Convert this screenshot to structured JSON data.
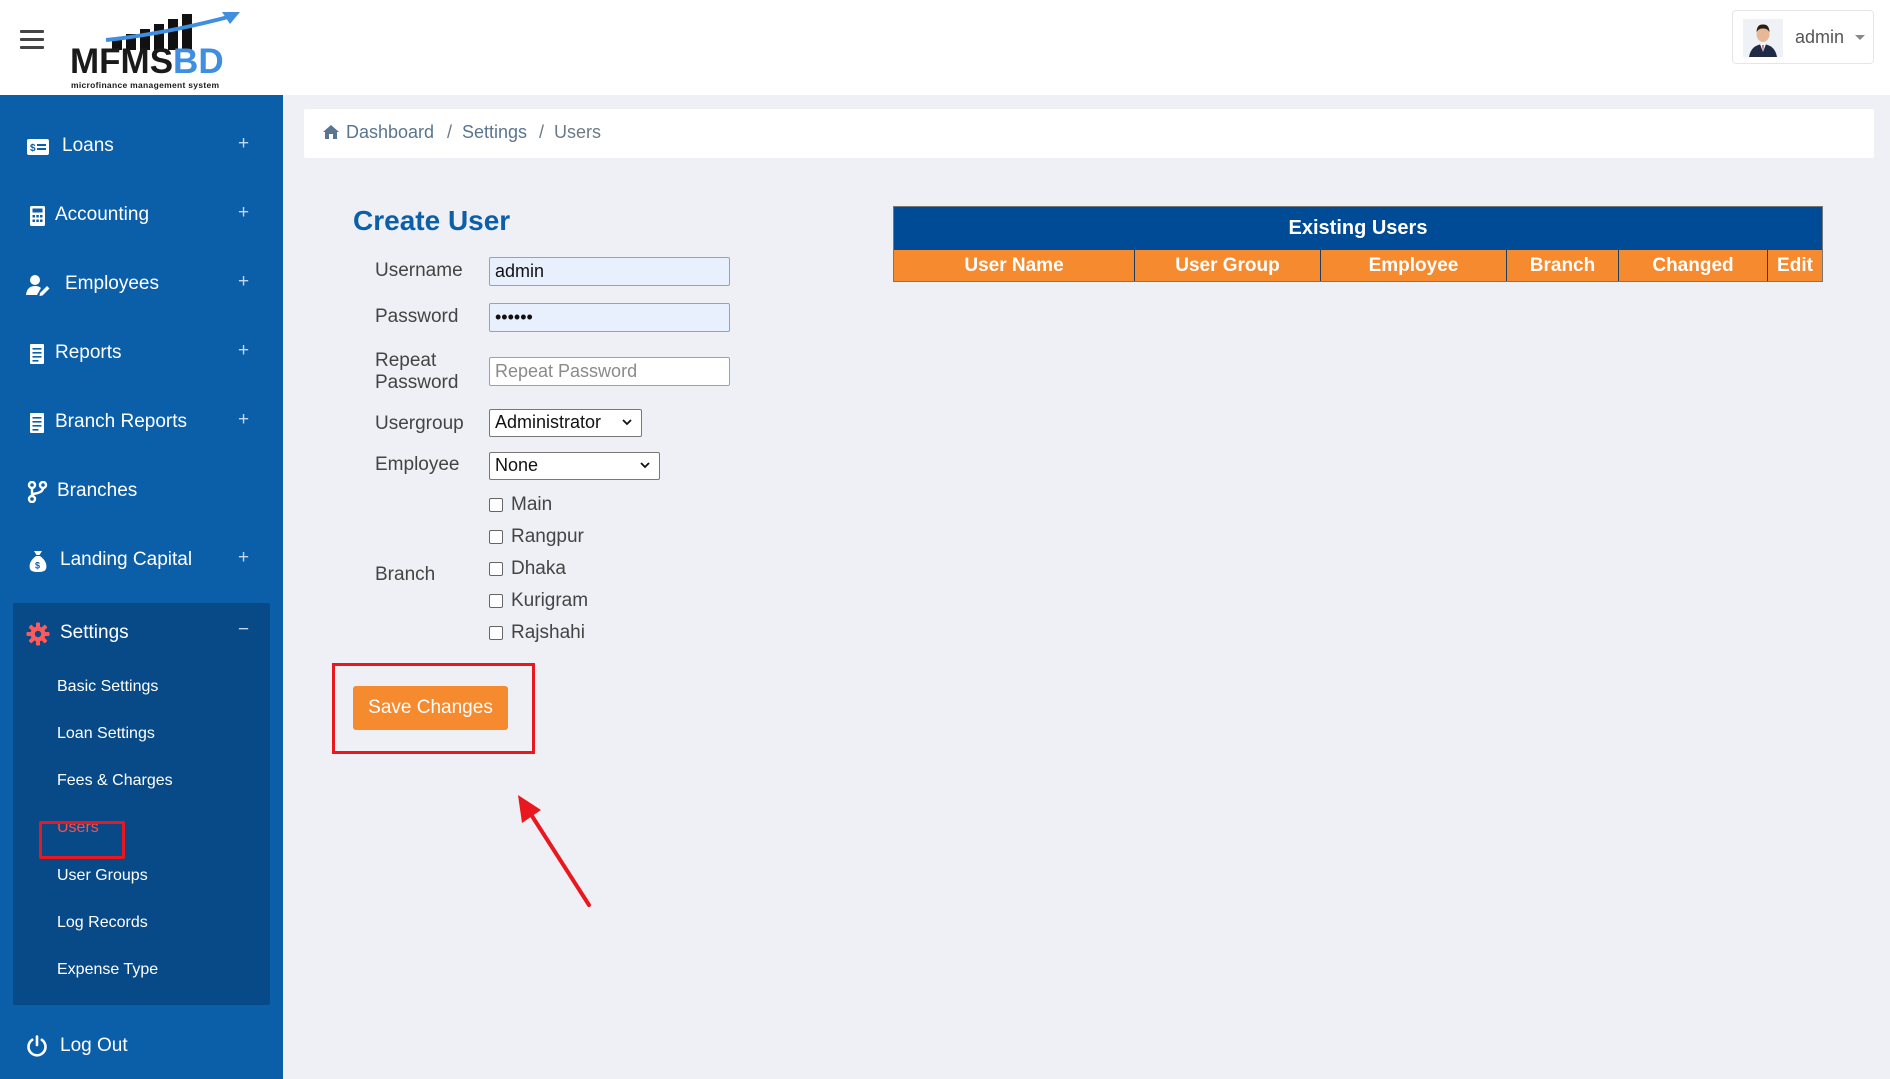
{
  "header": {
    "logo_main": "MFMS",
    "logo_accent": "BD",
    "logo_tagline": "microfinance management system",
    "user_name": "admin"
  },
  "sidebar": {
    "items": [
      {
        "label": "Loans",
        "icon": "id-card-icon",
        "expandable": true
      },
      {
        "label": "Accounting",
        "icon": "calculator-icon",
        "expandable": true
      },
      {
        "label": "Employees",
        "icon": "user-edit-icon",
        "expandable": true
      },
      {
        "label": "Reports",
        "icon": "file-report-icon",
        "expandable": true
      },
      {
        "label": "Branch Reports",
        "icon": "file-report-icon",
        "expandable": true
      },
      {
        "label": "Branches",
        "icon": "code-branch-icon",
        "expandable": false
      },
      {
        "label": "Landing Capital",
        "icon": "money-bag-icon",
        "expandable": true
      }
    ],
    "settings": {
      "label": "Settings",
      "icon": "gear-icon",
      "sub_items": [
        "Basic Settings",
        "Loan Settings",
        "Fees & Charges",
        "Users",
        "User Groups",
        "Log Records",
        "Expense Type"
      ],
      "active": "Users"
    },
    "logout_label": "Log Out"
  },
  "breadcrumb": [
    "Dashboard",
    "Settings",
    "Users"
  ],
  "form": {
    "title": "Create User",
    "username_label": "Username",
    "username_value": "admin",
    "password_label": "Password",
    "password_value": "••••••",
    "repeat_label_line1": "Repeat",
    "repeat_label_line2": "Password",
    "repeat_placeholder": "Repeat Password",
    "usergroup_label": "Usergroup",
    "usergroup_value": "Administrator",
    "employee_label": "Employee",
    "employee_value": "None",
    "branch_label": "Branch",
    "branches": [
      "Main",
      "Rangpur",
      "Dhaka",
      "Kurigram",
      "Rajshahi"
    ],
    "save_label": "Save Changes"
  },
  "table": {
    "title": "Existing Users",
    "columns": [
      "User Name",
      "User Group",
      "Employee",
      "Branch",
      "Changed",
      "Edit"
    ]
  },
  "colors": {
    "sidebar": "#0b5ea8",
    "sidebar_active_block": "#074a87",
    "accent_orange": "#f58a2e",
    "table_header_blue": "#004b96",
    "annotation_red": "#e8181e"
  }
}
